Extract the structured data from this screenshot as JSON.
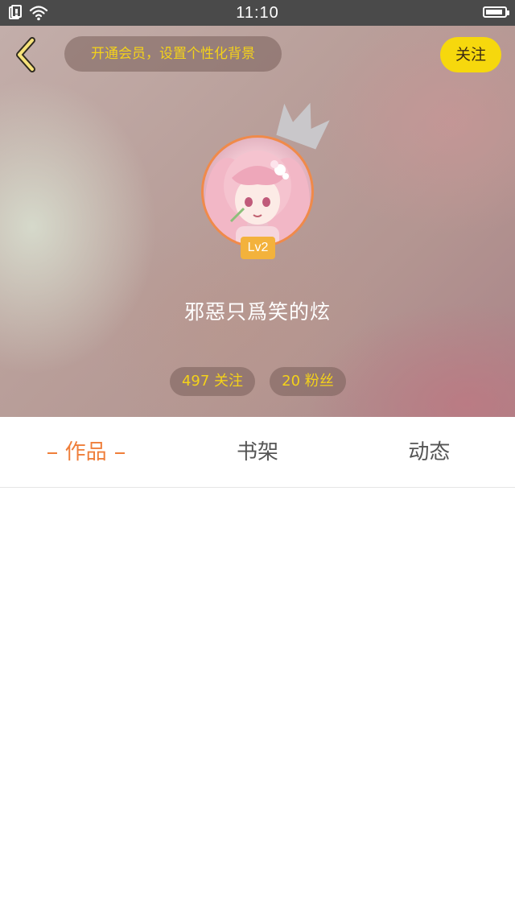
{
  "status_bar": {
    "time": "11:10",
    "battery_level": 0.9
  },
  "header": {
    "vip_prompt": "开通会员，设置个性化背景",
    "follow_label": "关注",
    "avatar": {
      "level": "Lv2"
    },
    "username": "邪惡只爲笑的炫",
    "stats": {
      "following": "497 关注",
      "fans": "20 粉丝"
    }
  },
  "tabs": [
    {
      "label": "作品",
      "active": true
    },
    {
      "label": "书架",
      "active": false
    },
    {
      "label": "动态",
      "active": false
    }
  ],
  "colors": {
    "accent": "#ef7e3a",
    "follow_bg": "#f6d80d",
    "pill_text": "#f4d21a",
    "level_badge": "#f3b23c"
  },
  "icons": [
    "sim-card-icon",
    "wifi-icon",
    "battery-icon",
    "back-arrow-icon",
    "crown-icon"
  ]
}
